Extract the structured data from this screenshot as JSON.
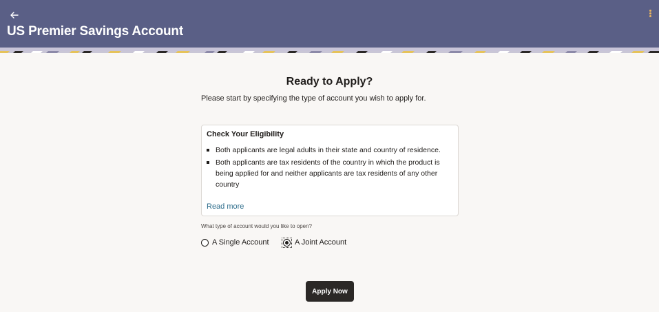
{
  "header": {
    "title": "US Premier Savings Account",
    "back_icon": "arrow-left-icon",
    "menu_icon": "kebab-menu-icon",
    "background_color": "#5a5f86"
  },
  "main": {
    "heading": "Ready to Apply?",
    "subtitle": "Please start by specifying the type of account you wish to apply for.",
    "eligibility": {
      "title": "Check Your Eligibility",
      "items": [
        "Both applicants are legal adults in their state and country of residence.",
        "Both applicants are tax residents of the country in which the product is being applied for and neither applicants are tax residents of any other country"
      ],
      "read_more": "Read more"
    },
    "account_type": {
      "question": "What type of account would you like to open?",
      "options": [
        {
          "label": "A Single Account",
          "selected": false
        },
        {
          "label": "A Joint Account",
          "selected": true
        }
      ]
    },
    "apply_button": "Apply Now"
  },
  "colors": {
    "accent_link": "#2f6e8c",
    "primary_button": "#2b2826",
    "page_background": "#f9f7f5"
  }
}
